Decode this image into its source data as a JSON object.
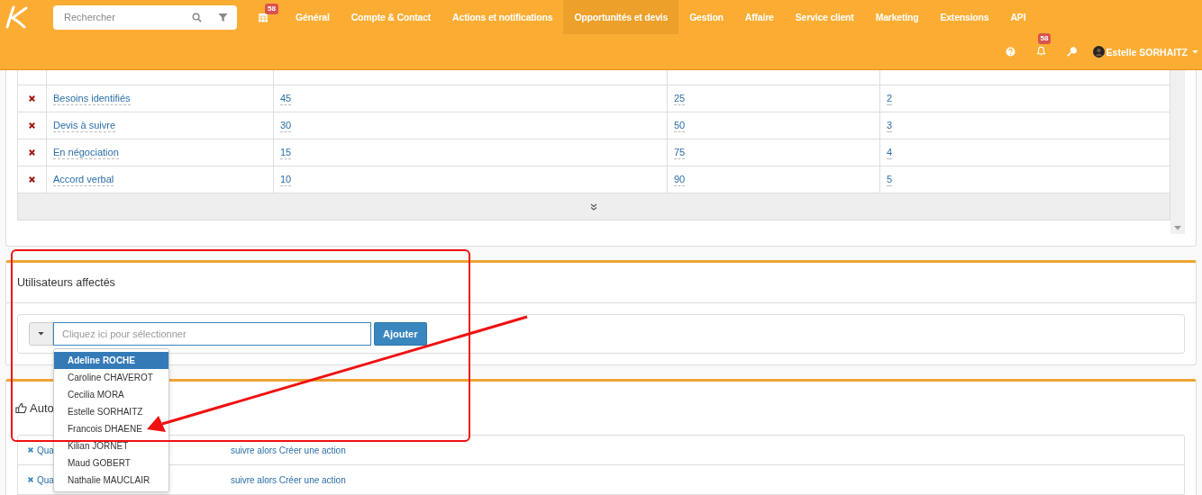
{
  "header": {
    "search": {
      "placeholder": "Rechercher"
    },
    "calendar_badge": "58",
    "nav": [
      {
        "label": "Général",
        "selected": false
      },
      {
        "label": "Compte & Contact",
        "selected": false
      },
      {
        "label": "Actions et notifications",
        "selected": false
      },
      {
        "label": "Opportunités et devis",
        "selected": true
      },
      {
        "label": "Gestion",
        "selected": false
      },
      {
        "label": "Affaire",
        "selected": false
      },
      {
        "label": "Service client",
        "selected": false
      },
      {
        "label": "Marketing",
        "selected": false
      },
      {
        "label": "Extensions",
        "selected": false
      },
      {
        "label": "API",
        "selected": false
      }
    ],
    "notifications_badge": "58",
    "user": "Estelle SORHAITZ"
  },
  "stages_table": {
    "rows": [
      {
        "name": "Besoins identifiés",
        "column_2": "45",
        "column_3": "25",
        "column_4": "2"
      },
      {
        "name": "Devis à suivre",
        "column_2": "30",
        "column_3": "50",
        "column_4": "3"
      },
      {
        "name": "En négociation",
        "column_2": "15",
        "column_3": "75",
        "column_4": "4"
      },
      {
        "name": "Accord verbal",
        "column_2": "10",
        "column_3": "90",
        "column_4": "5"
      }
    ]
  },
  "assigned_users": {
    "title": "Utilisateurs affectés",
    "select": {
      "placeholder": "Cliquez ici pour sélectionner"
    },
    "add_button": "Ajouter",
    "options": [
      {
        "label": "Adeline ROCHE",
        "selected": true
      },
      {
        "label": "Caroline CHAVEROT",
        "selected": false
      },
      {
        "label": "Cecilia MORA",
        "selected": false
      },
      {
        "label": "Estelle SORHAITZ",
        "selected": false
      },
      {
        "label": "Francois DHAENE",
        "selected": false
      },
      {
        "label": "Kilian JORNET",
        "selected": false
      },
      {
        "label": "Maud GOBERT",
        "selected": false
      },
      {
        "label": "Nathalie MAUCLAIR",
        "selected": false
      }
    ]
  },
  "automations": {
    "title": "Auto",
    "rows": [
      {
        "start": "Qua",
        "end": "suivre alors Créer une action"
      },
      {
        "start": "Qua",
        "end": "suivre alors Créer une action"
      }
    ]
  }
}
